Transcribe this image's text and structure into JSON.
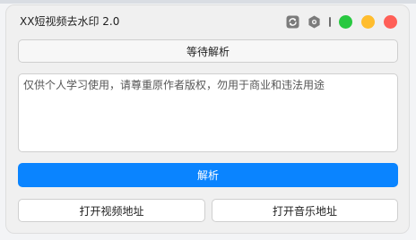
{
  "window": {
    "title": "XX短视频去水印 2.0"
  },
  "titlebar_icons": [
    "refresh-icon",
    "settings-icon"
  ],
  "traffic_lights": {
    "green": "#28c840",
    "yellow": "#ffbd2e",
    "red": "#ff5f57"
  },
  "status_button": {
    "label": "等待解析"
  },
  "input": {
    "value": "仅供个人学习使用，请尊重原作者版权，勿用于商业和违法用途"
  },
  "parse_button": {
    "label": "解析",
    "color": "#0a84ff"
  },
  "open_video_button": {
    "label": "打开视频地址"
  },
  "open_music_button": {
    "label": "打开音乐地址"
  }
}
